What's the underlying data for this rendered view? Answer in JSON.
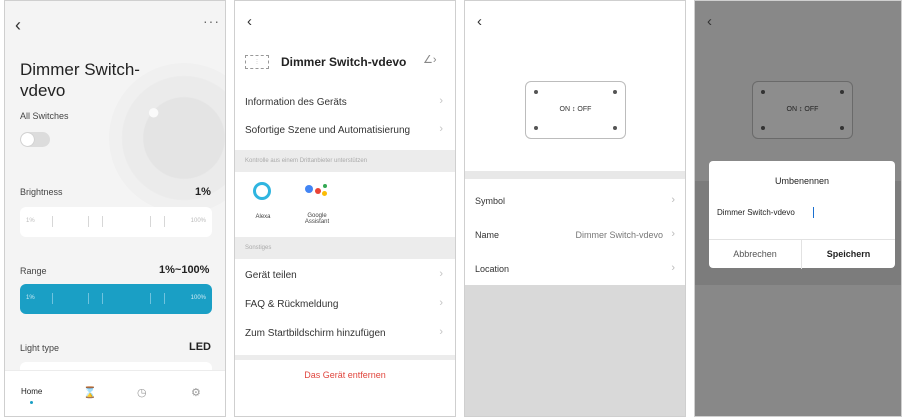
{
  "screen1": {
    "title": "Dimmer Switch-vdevo",
    "more": "···",
    "all_switches_label": "All Switches",
    "all_switches_on": false,
    "brightness_label": "Brightness",
    "brightness_value": "1%",
    "brightness_min": "1%",
    "brightness_max": "100%",
    "range_label": "Range",
    "range_value": "1%~100%",
    "range_min": "1%",
    "range_max": "100%",
    "light_type_label": "Light type",
    "light_type_value": "LED",
    "nav": {
      "home": "Home"
    },
    "accent_color": "#1a9fc5"
  },
  "screen2": {
    "device_name": "Dimmer Switch-vdevo",
    "rows_top": [
      {
        "label": "Information des Geräts"
      },
      {
        "label": "Sofortige Szene und Automatisierung"
      }
    ],
    "section_third_party": "Kontrolle aus einem Drittanbieter unterstützen",
    "services": [
      {
        "label": "Alexa"
      },
      {
        "label": "Google Assistant"
      }
    ],
    "section_other": "Sonstiges",
    "rows_bottom": [
      {
        "label": "Gerät teilen"
      },
      {
        "label": "FAQ & Rückmeldung"
      },
      {
        "label": "Zum Startbildschirm hinzufügen"
      }
    ],
    "remove_label": "Das Gerät entfernen",
    "remove_color": "#e0463e"
  },
  "screen3": {
    "panel_label": "ON ↕ OFF",
    "rows": [
      {
        "label": "Symbol",
        "value": ""
      },
      {
        "label": "Name",
        "value": "Dimmer Switch-vdevo"
      },
      {
        "label": "Location",
        "value": ""
      }
    ]
  },
  "screen4": {
    "panel_label": "ON ↕ OFF",
    "dialog_title": "Umbenennen",
    "input_value": "Dimmer Switch-vdevo",
    "cancel_label": "Abbrechen",
    "save_label": "Speichern"
  }
}
